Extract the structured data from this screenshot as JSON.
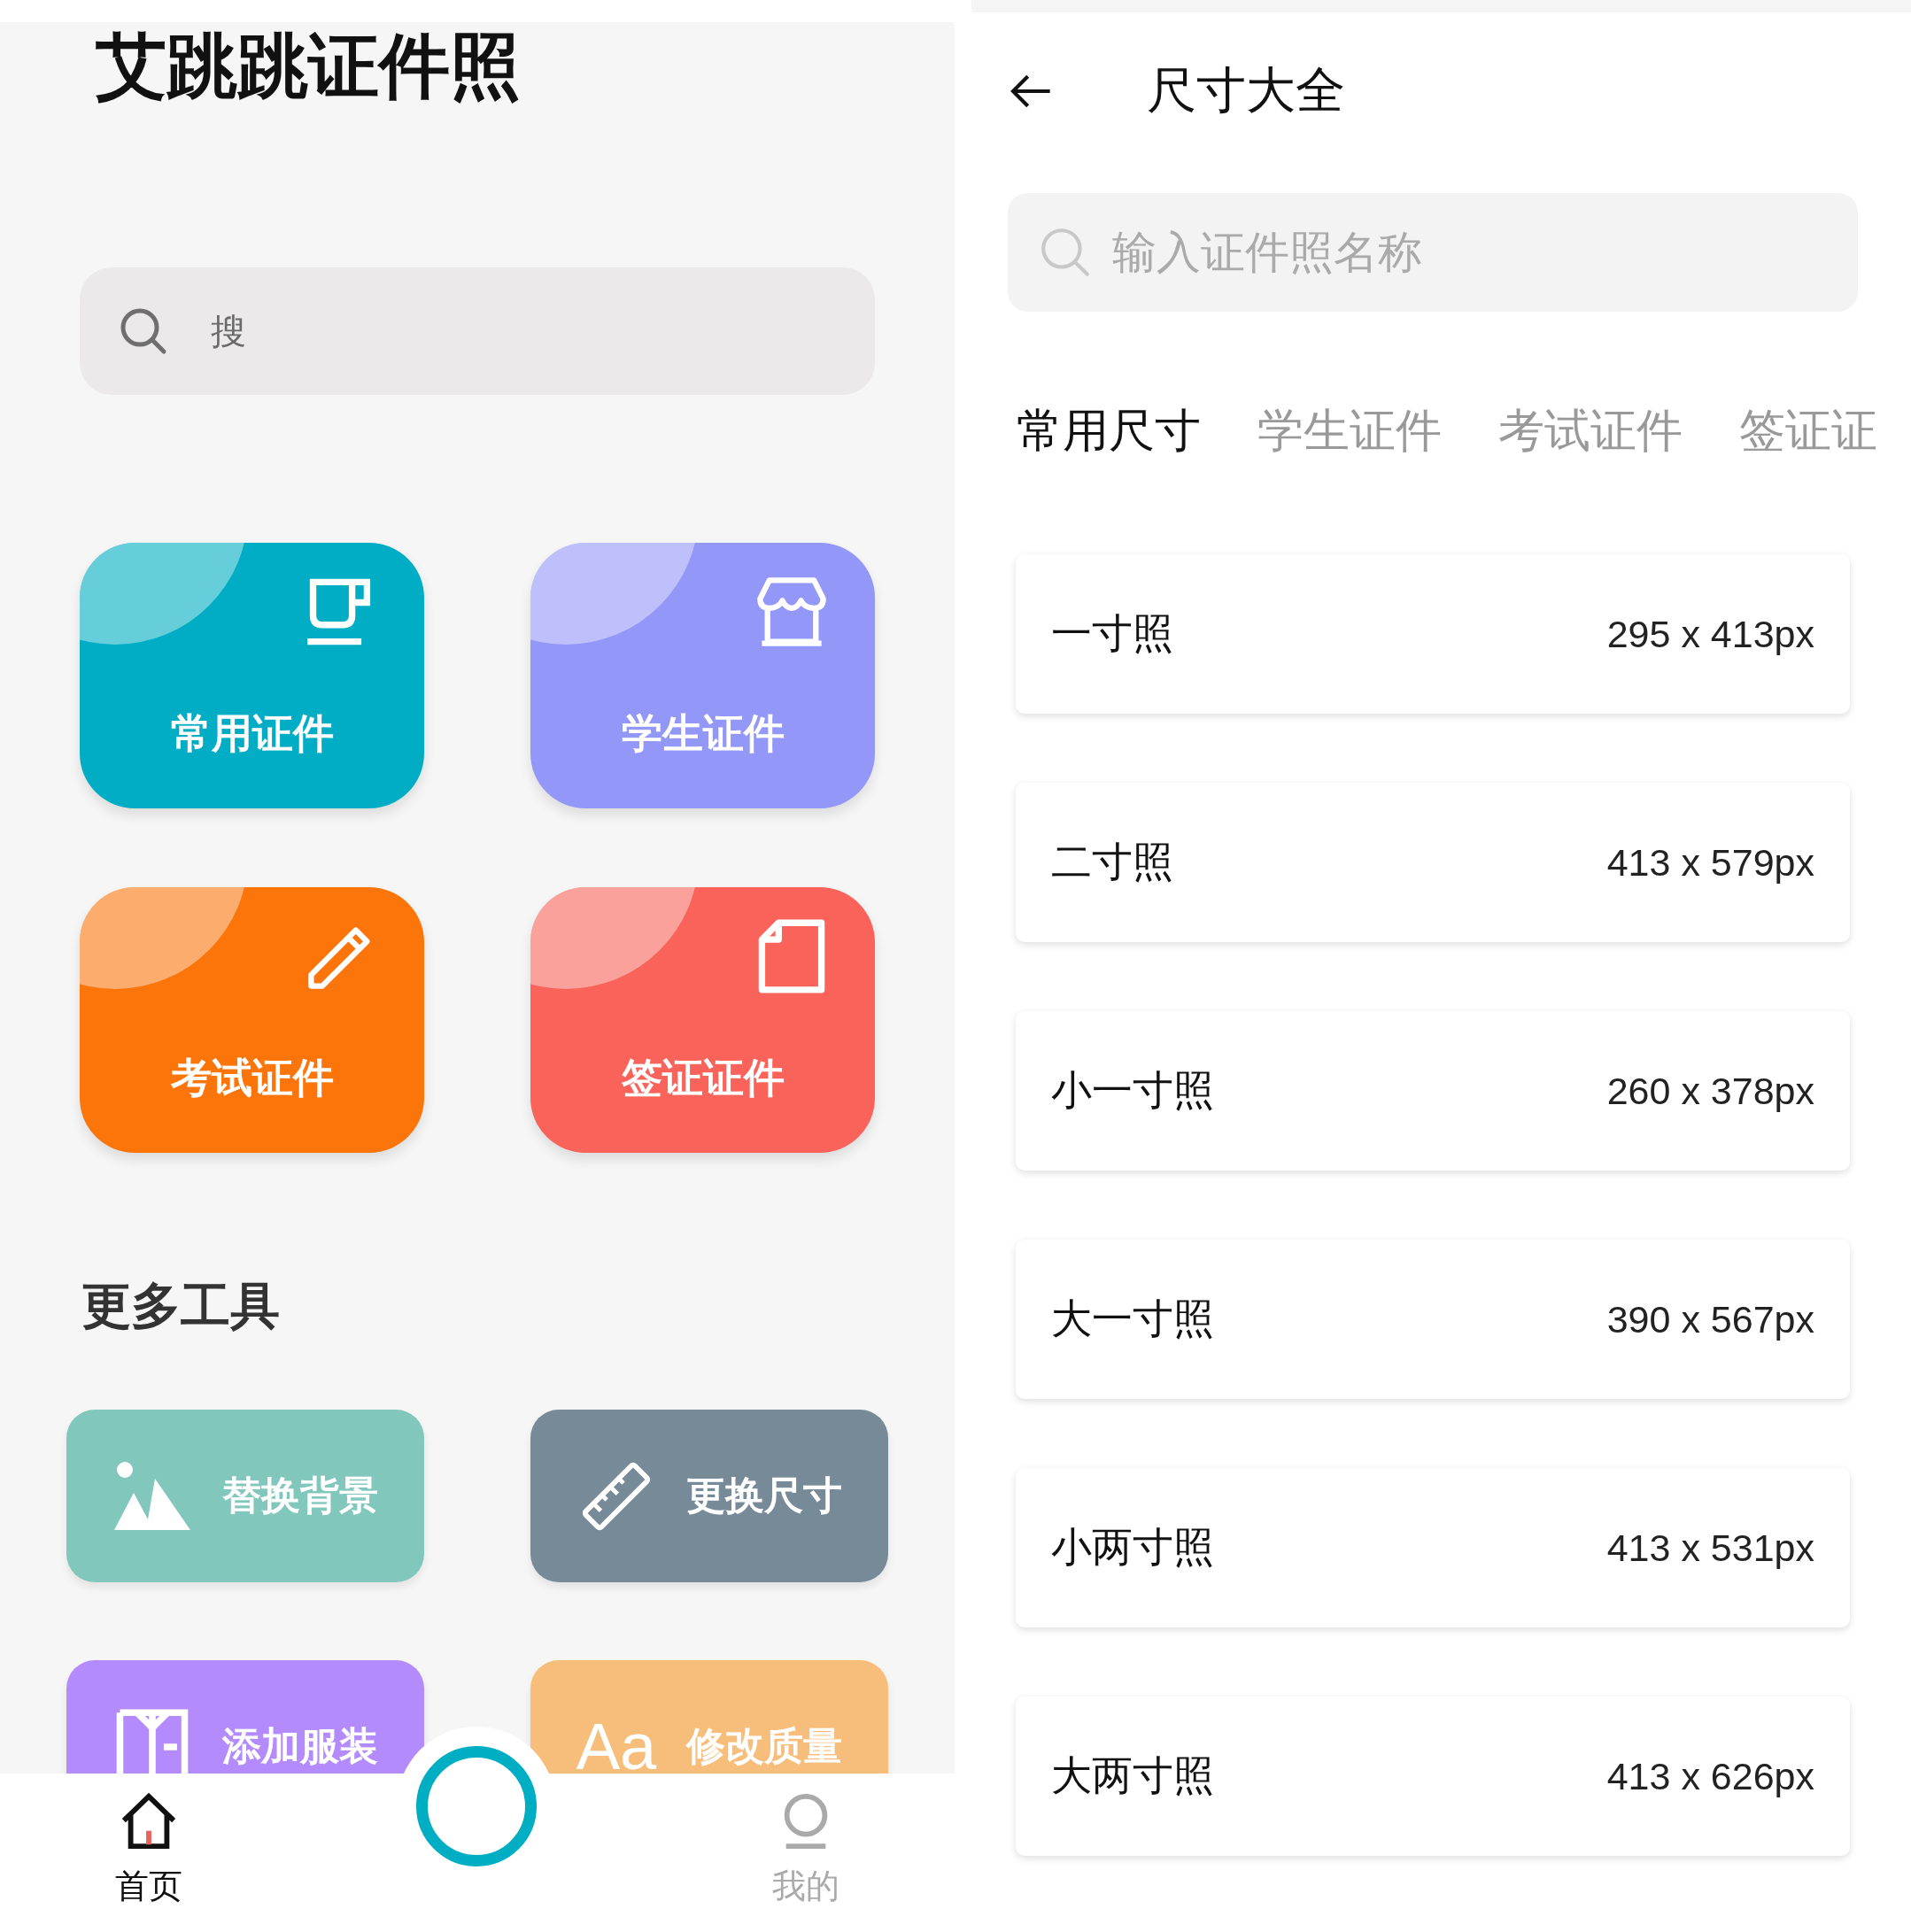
{
  "home": {
    "title": "艾跳跳证件照",
    "search": {
      "placeholder": "搜"
    },
    "categories": [
      {
        "label": "常用证件",
        "kind": "cup",
        "color": "#00adc4"
      },
      {
        "label": "学生证件",
        "kind": "store",
        "color": "#9297f8"
      },
      {
        "label": "考试证件",
        "kind": "pencil",
        "color": "#fb750b"
      },
      {
        "label": "签证证件",
        "kind": "document",
        "color": "#f9635a"
      }
    ],
    "section_title": "更多工具",
    "tools": [
      {
        "label": "替换背景",
        "kind": "mountains",
        "color": "#81c7bc"
      },
      {
        "label": "更换尺寸",
        "kind": "ruler",
        "color": "#778a98"
      },
      {
        "label": "添加服装",
        "kind": "shirt",
        "color": "#b38bfd"
      },
      {
        "label": "修改质量",
        "kind": "glyph",
        "glyph": "Aa",
        "color": "#f7bd7a"
      }
    ],
    "nav": [
      {
        "label": "首页",
        "kind": "home",
        "selected": true
      },
      {
        "label": "我的",
        "kind": "user",
        "selected": false
      }
    ]
  },
  "sizes": {
    "title": "尺寸大全",
    "search": {
      "placeholder": "输入证件照名称"
    },
    "tabs": [
      {
        "label": "常用尺寸",
        "selected": true
      },
      {
        "label": "学生证件",
        "selected": false
      },
      {
        "label": "考试证件",
        "selected": false
      },
      {
        "label": "签证证",
        "selected": false
      }
    ],
    "items": [
      {
        "name": "一寸照",
        "size": "295 x 413px"
      },
      {
        "name": "二寸照",
        "size": "413 x 579px"
      },
      {
        "name": "小一寸照",
        "size": "260 x 378px"
      },
      {
        "name": "大一寸照",
        "size": "390 x 567px"
      },
      {
        "name": "小两寸照",
        "size": "413 x 531px"
      },
      {
        "name": "大两寸照",
        "size": "413 x 626px"
      }
    ]
  }
}
